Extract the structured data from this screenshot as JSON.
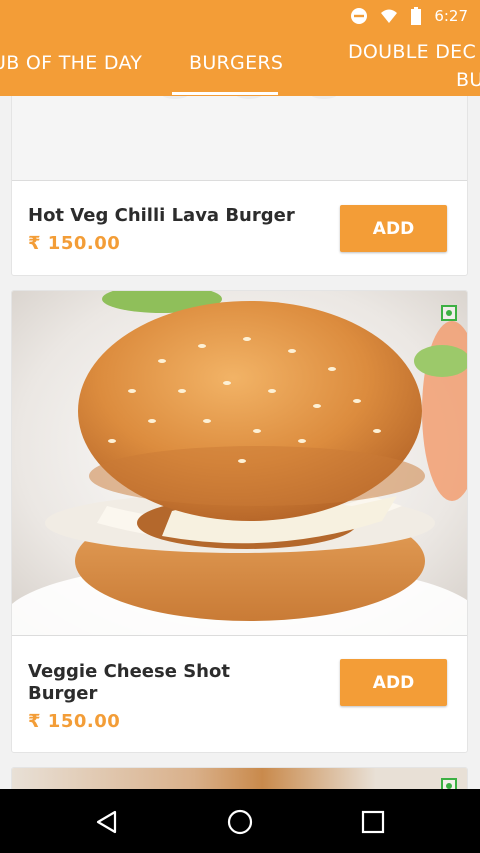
{
  "status_bar": {
    "time": "6:27",
    "icons": [
      "do-not-disturb-icon",
      "wifi-icon",
      "battery-icon"
    ]
  },
  "tabs": [
    {
      "label": "UB OF THE DAY"
    },
    {
      "label": "BURGERS",
      "selected": true
    },
    {
      "label_line1": "DOUBLE DEC",
      "label_line2": "BU"
    }
  ],
  "items": [
    {
      "name": "Hot Veg Chilli Lava Burger",
      "price": "₹ 150.00",
      "button": "ADD"
    },
    {
      "name": "Veggie Cheese Shot Burger",
      "price": "₹ 150.00",
      "button": "ADD",
      "veg": true
    },
    {
      "veg": true
    }
  ],
  "nav": {
    "icons": [
      "back-icon",
      "home-icon",
      "recents-icon"
    ]
  },
  "colors": {
    "accent": "#f39d37",
    "veg": "#3cb043",
    "nav": "#000000"
  }
}
